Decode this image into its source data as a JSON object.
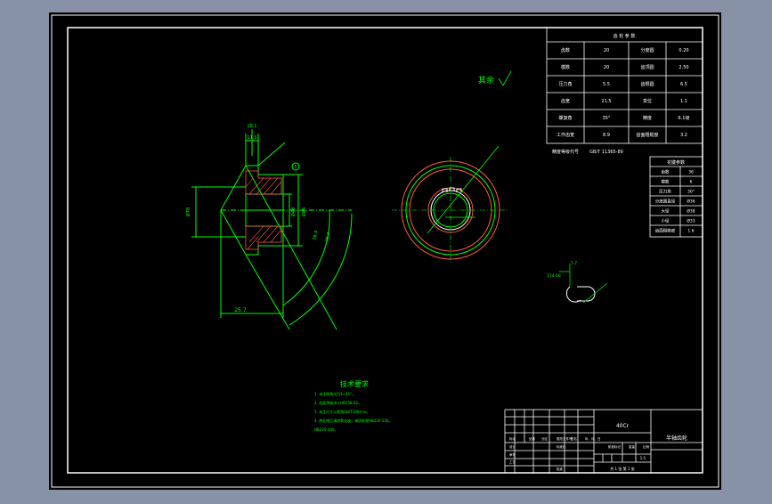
{
  "colors": {
    "background": "#8792a6",
    "paper": "#000000",
    "frame": "#ffffff",
    "geometry": "#00ff00",
    "dimension": "#00ff00",
    "hatch": "#ff5b3d",
    "text_white": "#ffffff"
  },
  "annotations": {
    "roughness_rest": "其余"
  },
  "dimensions": {
    "top_a": "18.1",
    "top_b": "11.5",
    "d_left": "Ø78",
    "d_right": "Ø84",
    "d_inner": "Ø48",
    "angle_mark": "5",
    "length": "25.7",
    "arc_a": "26.4",
    "arc_b": "26.4",
    "small_view_a": "5.7",
    "small_view_b": "174.66"
  },
  "gear_table": {
    "title": "齿 轮 参 数",
    "rows": [
      [
        "齿数",
        "20",
        "分度圆",
        "0.20"
      ],
      [
        "模数",
        "20",
        "齿顶圆",
        "2.50"
      ],
      [
        "压力角",
        "5.5",
        "齿根圆",
        "6.5"
      ],
      [
        "齿宽",
        "21.5",
        "变位",
        "1.1"
      ],
      [
        "螺旋角",
        "35°",
        "精度",
        "6.1级"
      ],
      [
        "工作齿宽",
        "8.9",
        "齿面粗糙度",
        "3.2"
      ],
      [
        "精度等级代号",
        "GB/T 11365-89",
        "",
        ""
      ]
    ]
  },
  "spline_table": {
    "title": "花键参数",
    "rows": [
      [
        "齿数",
        "36"
      ],
      [
        "模数",
        "6"
      ],
      [
        "压力角",
        "30°"
      ],
      [
        "分度圆直径",
        "Ø36"
      ],
      [
        "大径",
        "Ø38"
      ],
      [
        "小径",
        "Ø33"
      ],
      [
        "齿面粗糙度",
        "1.6"
      ]
    ]
  },
  "tech_requirements": {
    "title": "技术要求",
    "lines": [
      "1. 未注倒角均为1×45°。",
      "2. 齿面渗碳淬火HRC58-62。",
      "3. 未注尺寸公差按GB/T1804-m。",
      "4. 热处理后清除氧化皮，调质处理HB220-250。",
      "   HB235-265。"
    ]
  },
  "title_block": {
    "material": "40Cr",
    "part_name": "半轴齿轮",
    "scale": "1:1",
    "sheet": "共 1 张  第 1 张",
    "labels": [
      "标记",
      "处数",
      "分区",
      "更改文件号",
      "签名",
      "年、月、日",
      "设计",
      "标准化",
      "审核",
      "工艺",
      "批准",
      "阶段标记",
      "重量",
      "比例"
    ]
  }
}
